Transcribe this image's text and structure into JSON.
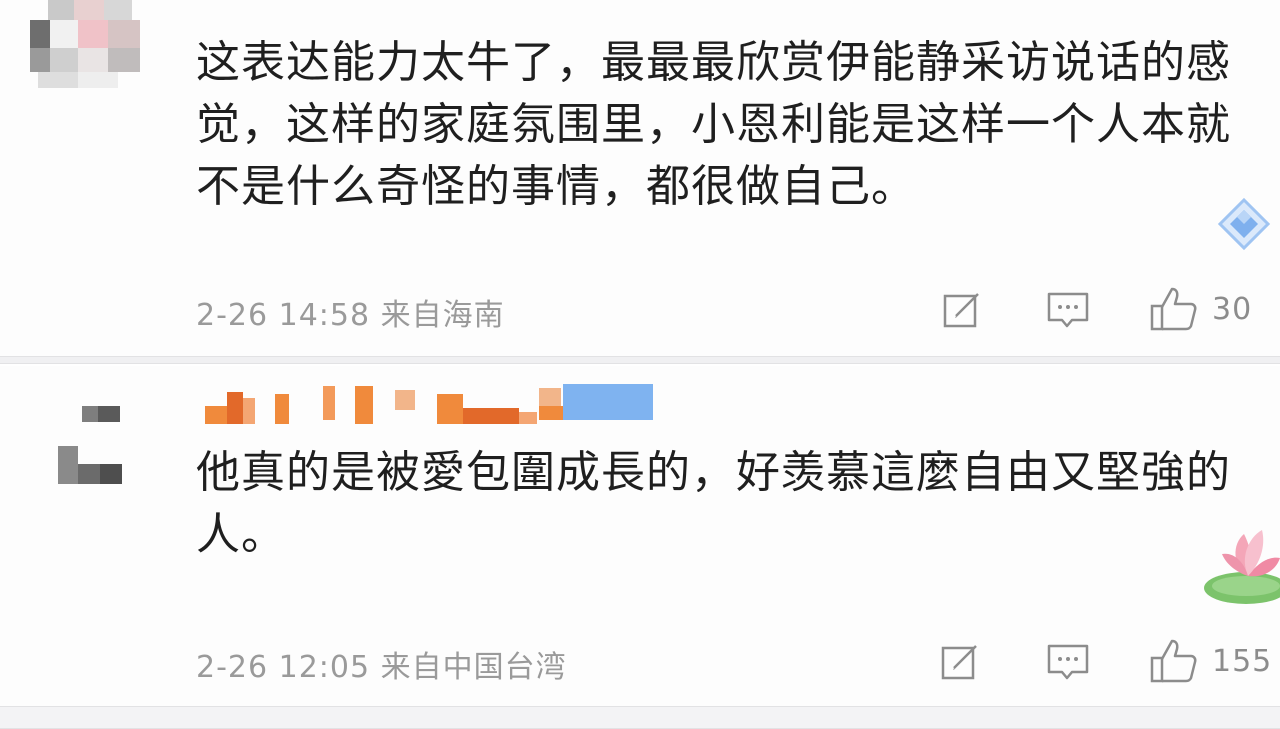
{
  "comments": [
    {
      "text": "这表达能力太牛了，最最最欣赏伊能静采访说话的感觉，这样的家庭氛围里，小恩利能是这样一个人本就不是什么奇怪的事情，都很做自己。",
      "meta": "2-26 14:58 来自海南",
      "likes": "30"
    },
    {
      "text": "他真的是被愛包圍成長的，好羡慕這麼自由又堅強的人。",
      "meta": "2-26 12:05 来自中国台湾",
      "likes": "155"
    }
  ],
  "icons": {
    "edit": "edit-icon",
    "reply": "comment-icon",
    "like": "thumbs-up-icon"
  },
  "colors": {
    "text": "#1f1f1f",
    "meta": "#9a9a9a",
    "username_orange": "#f08a3c",
    "username_blue": "#7fb3f0"
  }
}
